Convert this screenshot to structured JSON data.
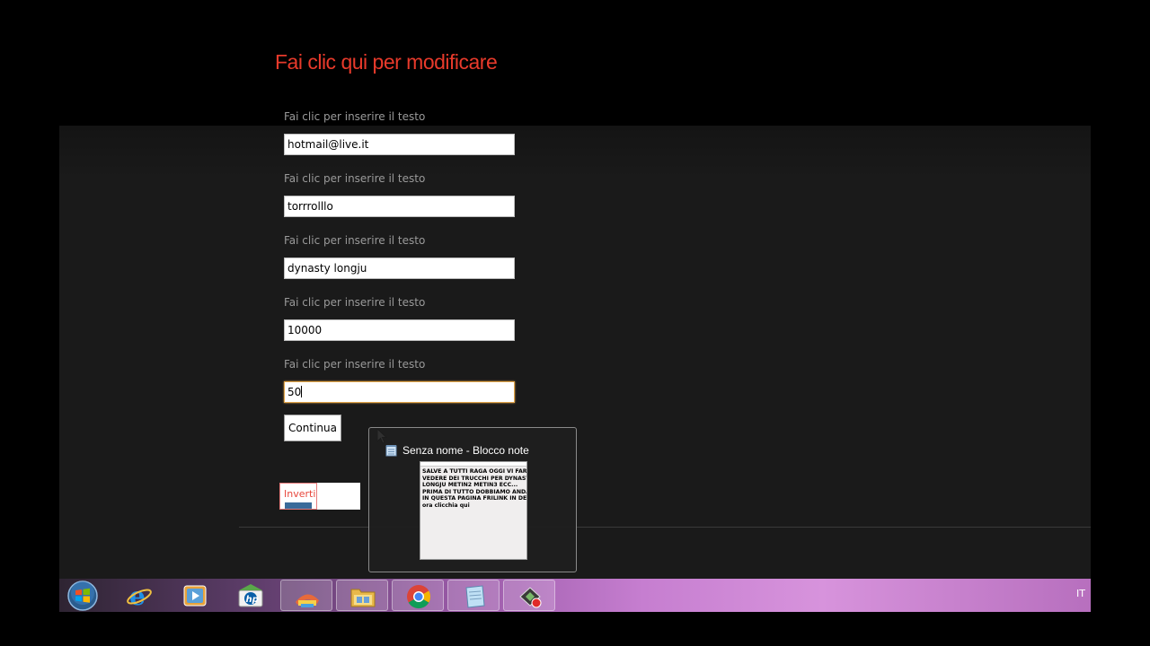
{
  "page": {
    "title": "Fai clic qui per modificare",
    "fields": [
      {
        "label": "Fai clic per inserire il testo",
        "value": "hotmail@live.it"
      },
      {
        "label": "Fai clic per inserire il testo",
        "value": "torrrolllo"
      },
      {
        "label": "Fai clic per inserire il testo",
        "value": "dynasty longju"
      },
      {
        "label": "Fai clic per inserire il testo",
        "value": "10000"
      },
      {
        "label": "Fai clic per inserire il testo",
        "value": "50"
      }
    ],
    "continue_label": "Continua",
    "inverti_label": "Inverti"
  },
  "thumbnail": {
    "title": "Senza nome - Blocco note",
    "preview_text": "SALVE A TUTTI RAGA OGGI VI FARò\nVEDERE DEI TRUCCHI PER DYNASTY\nLONGJU METIN2 METIN3 ECC...\nPRIMA DI TUTTO DOBBIAMO ANDARE\nIN QUESTA PAGINA FRILINK IN DESCRIZIO\nora clicchia qui"
  },
  "taskbar": {
    "items": [
      {
        "name": "start-button",
        "icon": "windows-logo-icon"
      },
      {
        "name": "internet-explorer",
        "icon": "internet-explorer-icon"
      },
      {
        "name": "media-player",
        "icon": "media-player-icon"
      },
      {
        "name": "hp",
        "icon": "hp-icon"
      },
      {
        "name": "paint",
        "icon": "paint-icon"
      },
      {
        "name": "explorer",
        "icon": "folder-icon"
      },
      {
        "name": "chrome",
        "icon": "chrome-icon"
      },
      {
        "name": "notepad",
        "icon": "notepad-icon"
      },
      {
        "name": "recorder",
        "icon": "recorder-icon"
      }
    ],
    "language": "IT"
  },
  "colors": {
    "title": "#e83a2b",
    "label": "#9a9a9a",
    "focus_border": "#e2a54a"
  }
}
